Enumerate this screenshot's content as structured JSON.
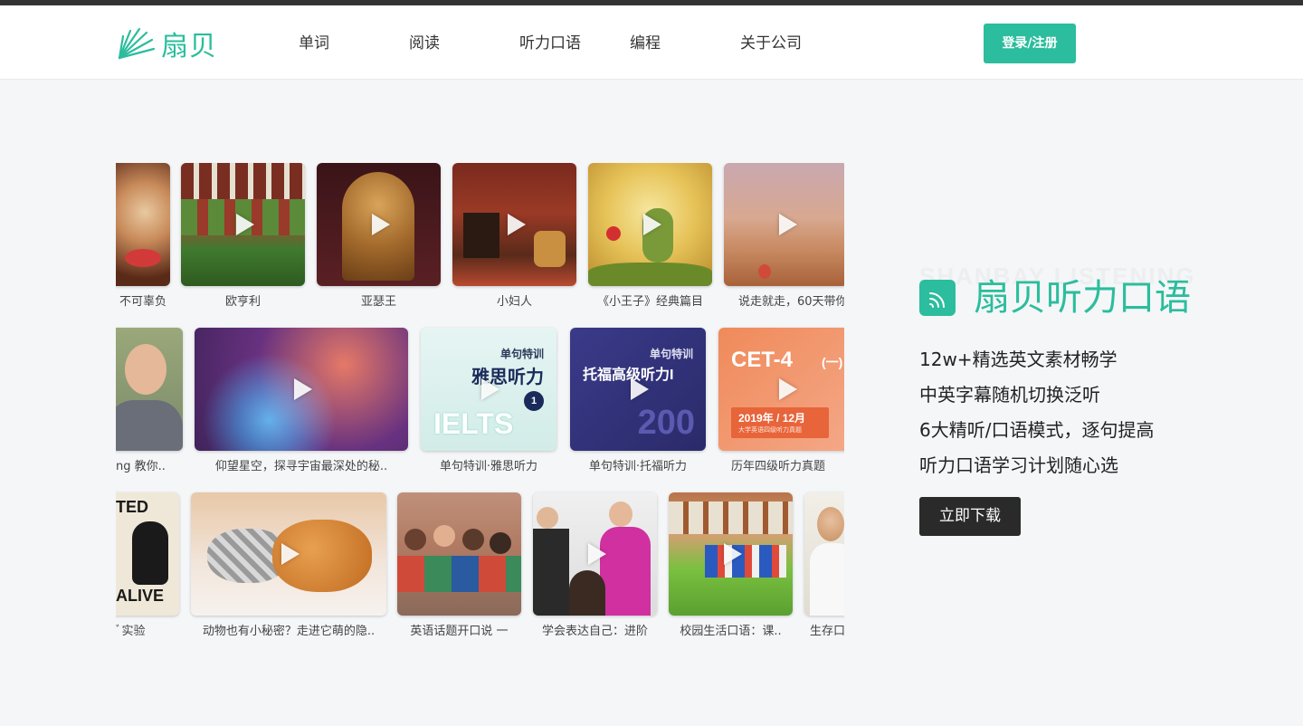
{
  "brand": {
    "name": "扇贝",
    "accent": "#2bbd9d"
  },
  "nav": {
    "items": [
      "单词",
      "阅读",
      "听力口语",
      "编程",
      "关于公司"
    ],
    "login": "登录/注册"
  },
  "gallery": {
    "rows": [
      {
        "cards": [
          {
            "caption": "不可辜负",
            "image": "food-plate"
          },
          {
            "caption": "欧亨利",
            "image": "ivy-house"
          },
          {
            "caption": "亚瑟王",
            "image": "throne"
          },
          {
            "caption": "小妇人",
            "image": "living-room"
          },
          {
            "caption": "《小王子》经典篇目",
            "image": "little-prince"
          },
          {
            "caption": "说走就走，60天带你",
            "image": "hot-air-balloons"
          }
        ]
      },
      {
        "cards": [
          {
            "caption": "ng 教你..",
            "image": "man-portrait"
          },
          {
            "caption": "仰望星空，探寻宇宙最深处的秘..",
            "image": "nebula"
          },
          {
            "caption": "单句特训·雅思听力",
            "image": "ielts-cover",
            "cover": {
              "tag": "单句特训",
              "title": "雅思听力",
              "big": "IELTS",
              "num": "1"
            }
          },
          {
            "caption": "单句特训·托福听力",
            "image": "toefl-cover",
            "cover": {
              "tag": "单句特训",
              "title": "托福高级听力I",
              "big": "200"
            }
          },
          {
            "caption": "历年四级听力真题",
            "image": "cet4-cover",
            "cover": {
              "title": "CET-4",
              "suffix": "(一)",
              "date": "2019年 / 12月",
              "sub": "大学英语四级听力真题"
            }
          }
        ]
      },
      {
        "cards": [
          {
            "caption": "ﾞ实验",
            "image": "cat-poster",
            "cover": {
              "top": "TED",
              "bottom": "ALIVE"
            }
          },
          {
            "caption": "动物也有小秘密？走进它萌的隐..",
            "image": "cat-dog-sleeping"
          },
          {
            "caption": "英语话题开口说 一",
            "image": "friends-group"
          },
          {
            "caption": "学会表达自己：进阶",
            "image": "classroom"
          },
          {
            "caption": "校园生活口语：课..",
            "image": "campus-lawn"
          },
          {
            "caption": "生存口",
            "image": "girl-portrait"
          }
        ]
      }
    ]
  },
  "product": {
    "ghost": "SHANBAY LISTENING",
    "title": "扇贝听力口语",
    "features": [
      "12w+精选英文素材畅学",
      "中英字幕随机切换泛听",
      "6大精听/口语模式，逐句提高",
      "听力口语学习计划随心选"
    ],
    "download": "立即下载"
  }
}
